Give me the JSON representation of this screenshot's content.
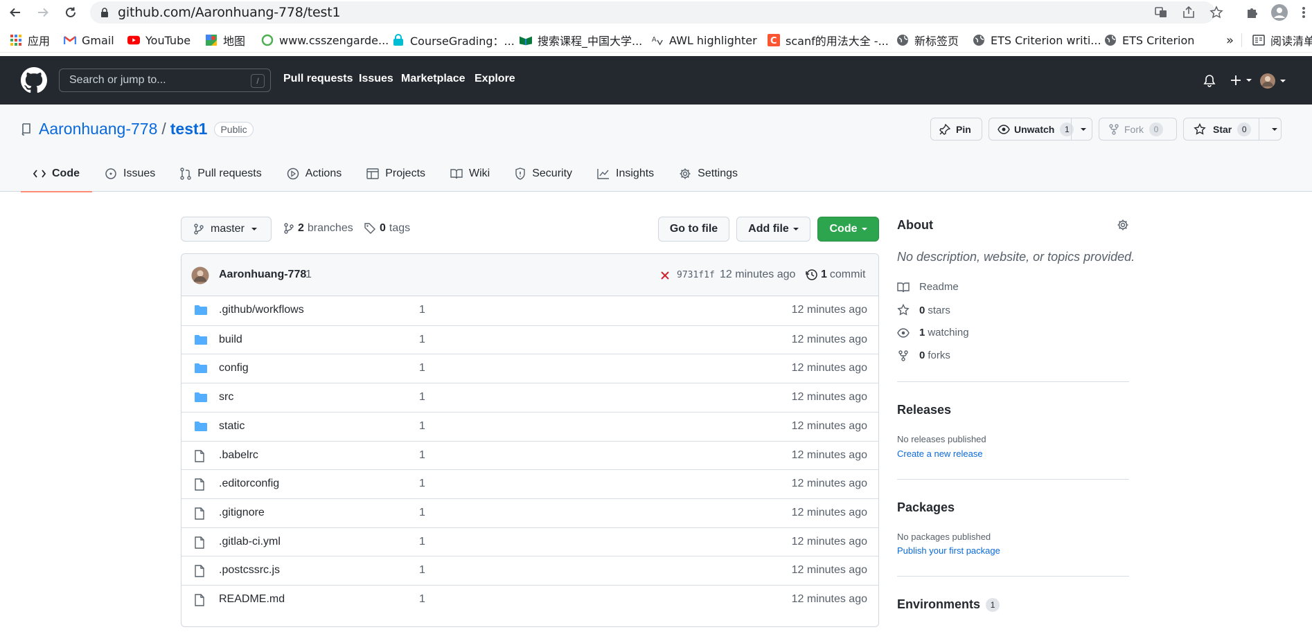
{
  "browser": {
    "url": "github.com/Aaronhuang-778/test1",
    "bookmarks": [
      {
        "label": "应用",
        "icon": "apps-grid-icon"
      },
      {
        "label": "Gmail",
        "icon": "gmail-icon"
      },
      {
        "label": "YouTube",
        "icon": "youtube-icon"
      },
      {
        "label": "地图",
        "icon": "maps-icon"
      },
      {
        "label": "www.csszengarde...",
        "icon": "globe-icon"
      },
      {
        "label": "CourseGrading：...",
        "icon": "lock-icon"
      },
      {
        "label": "搜索课程_中国大学...",
        "icon": "course-icon"
      },
      {
        "label": "AWL highlighter",
        "icon": "translate-icon"
      },
      {
        "label": "scanf的用法大全 -...",
        "icon": "csdn-icon"
      },
      {
        "label": "新标签页",
        "icon": "globe-icon"
      },
      {
        "label": "ETS Criterion writi...",
        "icon": "globe-icon"
      },
      {
        "label": "ETS Criterion",
        "icon": "globe-icon"
      }
    ],
    "overflow": "»",
    "reading_list": "阅读清单"
  },
  "header": {
    "search_placeholder": "Search or jump to...",
    "search_shortcut": "/",
    "nav": [
      "Pull requests",
      "Issues",
      "Marketplace",
      "Explore"
    ]
  },
  "repo": {
    "owner": "Aaronhuang-778",
    "separator": "/",
    "name": "test1",
    "visibility": "Public",
    "pin_label": "Pin",
    "watch_label": "Unwatch",
    "watch_count": "1",
    "fork_label": "Fork",
    "fork_count": "0",
    "star_label": "Star",
    "star_count": "0"
  },
  "tabs": [
    {
      "label": "Code",
      "icon": "code-icon"
    },
    {
      "label": "Issues",
      "icon": "issue-icon"
    },
    {
      "label": "Pull requests",
      "icon": "pull-request-icon"
    },
    {
      "label": "Actions",
      "icon": "play-icon"
    },
    {
      "label": "Projects",
      "icon": "table-icon"
    },
    {
      "label": "Wiki",
      "icon": "book-icon"
    },
    {
      "label": "Security",
      "icon": "shield-icon"
    },
    {
      "label": "Insights",
      "icon": "graph-icon"
    },
    {
      "label": "Settings",
      "icon": "gear-icon"
    }
  ],
  "toolbar": {
    "branch": "master",
    "branches_count": "2",
    "branches_label": "branches",
    "tags_count": "0",
    "tags_label": "tags",
    "go_to_file": "Go to file",
    "add_file": "Add file",
    "code": "Code"
  },
  "commit": {
    "author": "Aaronhuang-778",
    "message": "1",
    "sha": "9731f1f",
    "age": "12 minutes ago",
    "count": "1",
    "count_label": "commit"
  },
  "files": [
    {
      "type": "dir",
      "name": ".github/workflows",
      "message": "1",
      "age": "12 minutes ago"
    },
    {
      "type": "dir",
      "name": "build",
      "message": "1",
      "age": "12 minutes ago"
    },
    {
      "type": "dir",
      "name": "config",
      "message": "1",
      "age": "12 minutes ago"
    },
    {
      "type": "dir",
      "name": "src",
      "message": "1",
      "age": "12 minutes ago"
    },
    {
      "type": "dir",
      "name": "static",
      "message": "1",
      "age": "12 minutes ago"
    },
    {
      "type": "file",
      "name": ".babelrc",
      "message": "1",
      "age": "12 minutes ago"
    },
    {
      "type": "file",
      "name": ".editorconfig",
      "message": "1",
      "age": "12 minutes ago"
    },
    {
      "type": "file",
      "name": ".gitignore",
      "message": "1",
      "age": "12 minutes ago"
    },
    {
      "type": "file",
      "name": ".gitlab-ci.yml",
      "message": "1",
      "age": "12 minutes ago"
    },
    {
      "type": "file",
      "name": ".postcssrc.js",
      "message": "1",
      "age": "12 minutes ago"
    },
    {
      "type": "file",
      "name": "README.md",
      "message": "1",
      "age": "12 minutes ago"
    }
  ],
  "about": {
    "title": "About",
    "description": "No description, website, or topics provided.",
    "readme": "Readme",
    "stars_count": "0",
    "stars_label": "stars",
    "watching_count": "1",
    "watching_label": "watching",
    "forks_count": "0",
    "forks_label": "forks"
  },
  "releases": {
    "title": "Releases",
    "empty": "No releases published",
    "link": "Create a new release"
  },
  "packages": {
    "title": "Packages",
    "empty": "No packages published",
    "link": "Publish your first package"
  },
  "environments": {
    "title": "Environments",
    "count": "1"
  },
  "colors": {
    "header_bg": "#24292f",
    "link": "#0969da",
    "green_button": "#2da44e",
    "folder": "#54aeff",
    "tab_underline": "#fd8c73",
    "fail_x": "#cf222e"
  }
}
